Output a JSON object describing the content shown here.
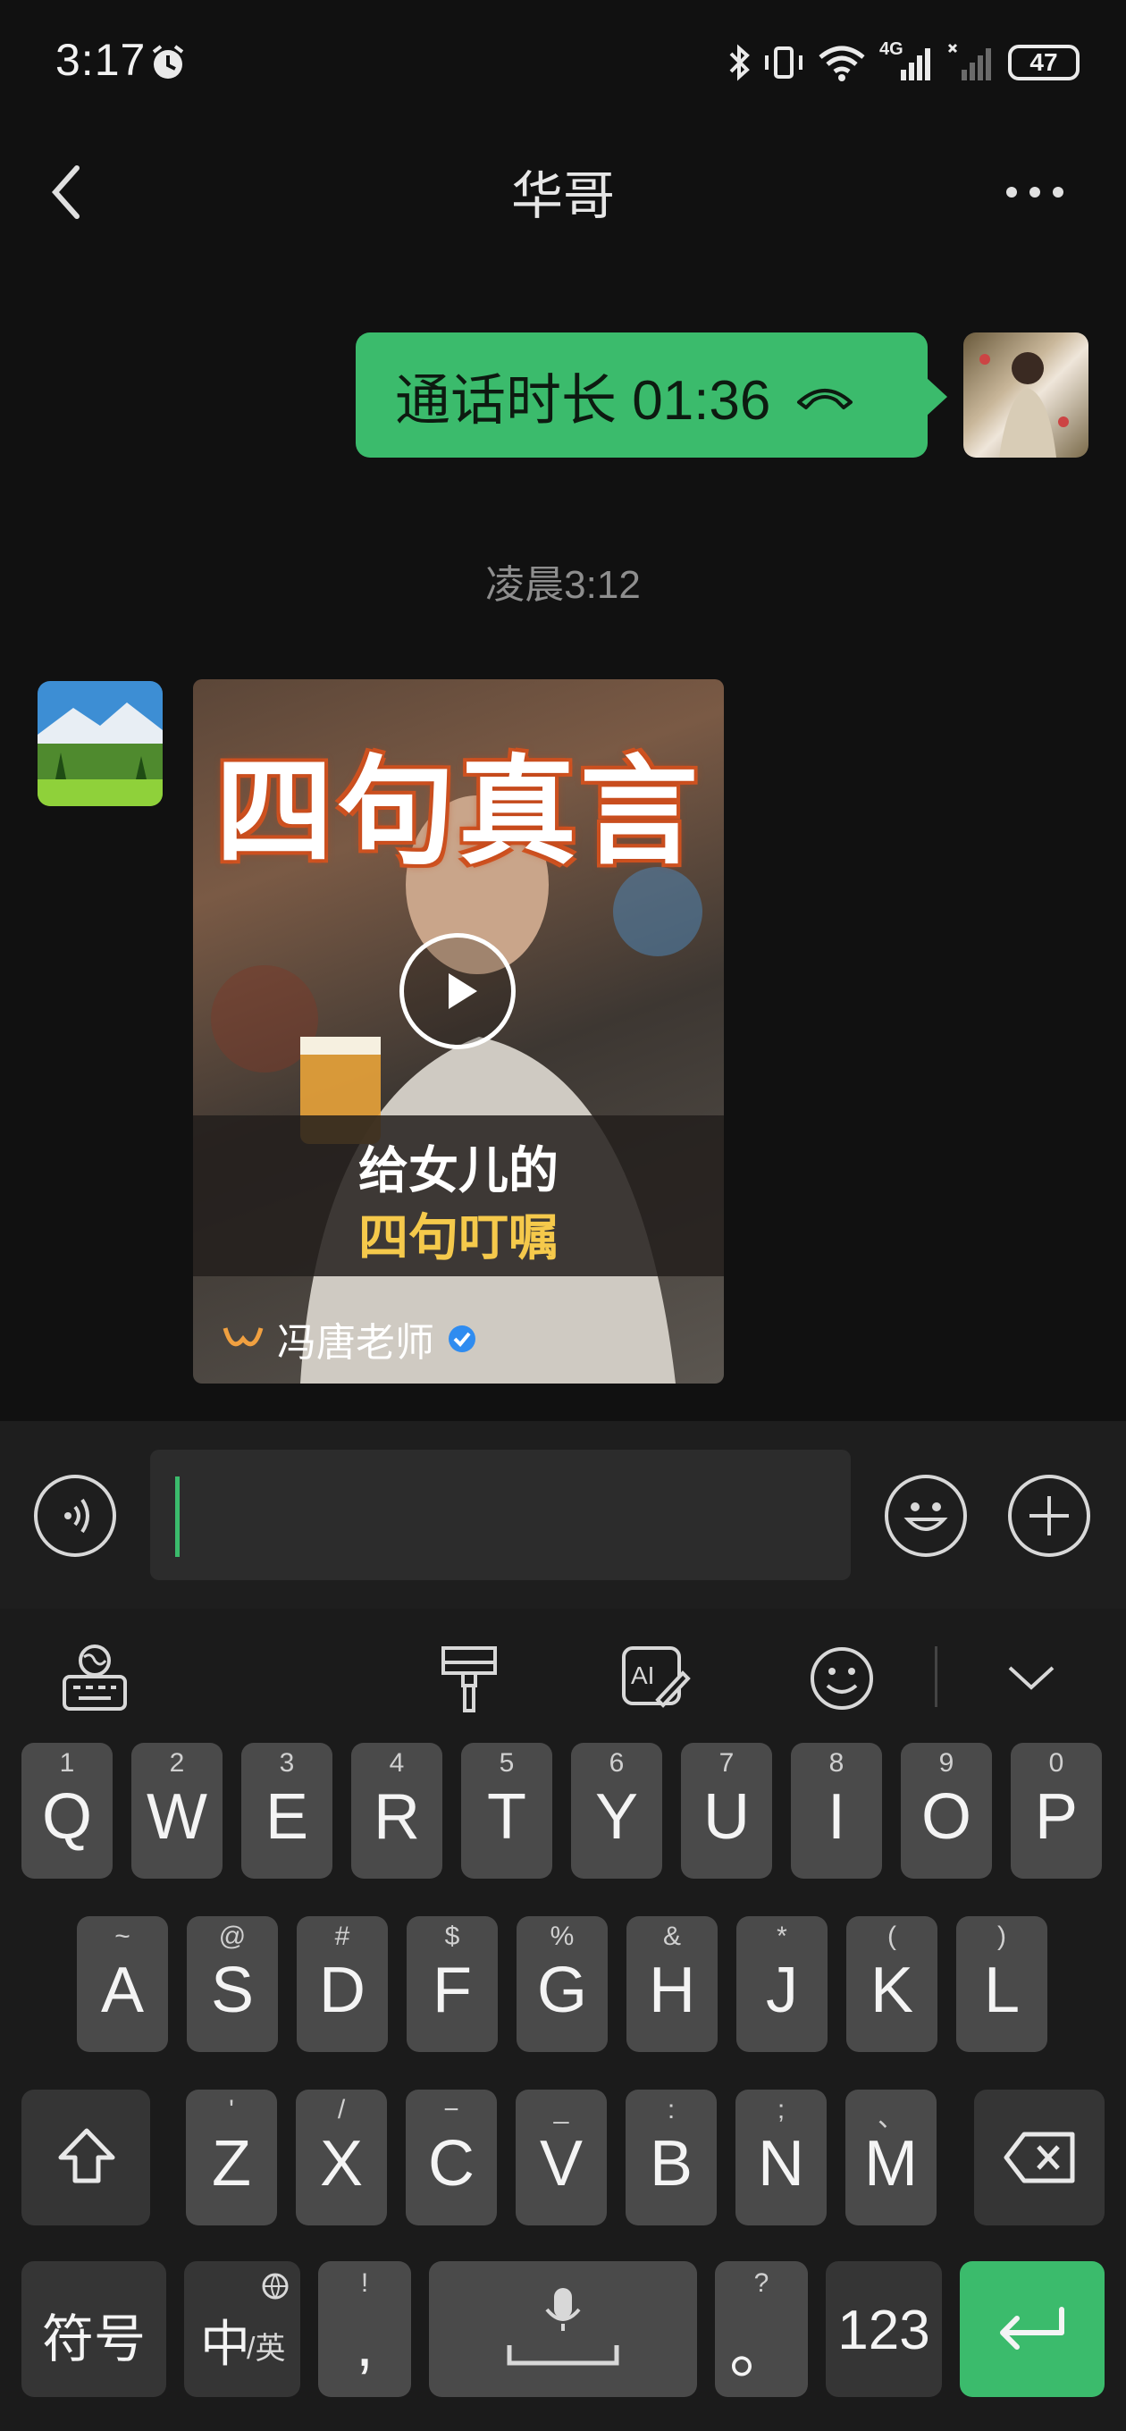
{
  "status": {
    "time": "3:17",
    "battery": "47",
    "network": "4G"
  },
  "header": {
    "title": "华哥"
  },
  "messages": {
    "call_text": "通话时长 01:36",
    "timestamp": "凌晨3:12",
    "video": {
      "title": "四句真言",
      "caption_line1": "给女儿的",
      "caption_line2": "四句叮嘱",
      "author": "冯唐老师"
    }
  },
  "input": {
    "value": ""
  },
  "keyboard": {
    "row1": [
      {
        "num": "1",
        "key": "Q"
      },
      {
        "num": "2",
        "key": "W"
      },
      {
        "num": "3",
        "key": "E"
      },
      {
        "num": "4",
        "key": "R"
      },
      {
        "num": "5",
        "key": "T"
      },
      {
        "num": "6",
        "key": "Y"
      },
      {
        "num": "7",
        "key": "U"
      },
      {
        "num": "8",
        "key": "I"
      },
      {
        "num": "9",
        "key": "O"
      },
      {
        "num": "0",
        "key": "P"
      }
    ],
    "row2": [
      {
        "sym": "~",
        "key": "A"
      },
      {
        "sym": "@",
        "key": "S"
      },
      {
        "sym": "#",
        "key": "D"
      },
      {
        "sym": "$",
        "key": "F"
      },
      {
        "sym": "%",
        "key": "G"
      },
      {
        "sym": "&",
        "key": "H"
      },
      {
        "sym": "*",
        "key": "J"
      },
      {
        "sym": "(",
        "key": "K"
      },
      {
        "sym": ")",
        "key": "L"
      }
    ],
    "row3": [
      {
        "sym": "'",
        "key": "Z"
      },
      {
        "sym": "/",
        "key": "X"
      },
      {
        "sym": "−",
        "key": "C"
      },
      {
        "sym": "_",
        "key": "V"
      },
      {
        "sym": ":",
        "key": "B"
      },
      {
        "sym": ";",
        "key": "N"
      },
      {
        "sym": "、",
        "key": "M"
      }
    ],
    "symbols_label": "符号",
    "lang_main": "中",
    "lang_sub": "/英",
    "comma_hint": "!",
    "comma": ",",
    "period_hint": "?",
    "period": "。",
    "numbers_label": "123"
  },
  "colors": {
    "accent": "#3bbb6c",
    "background": "#111111",
    "key": "#4a4a4a"
  }
}
